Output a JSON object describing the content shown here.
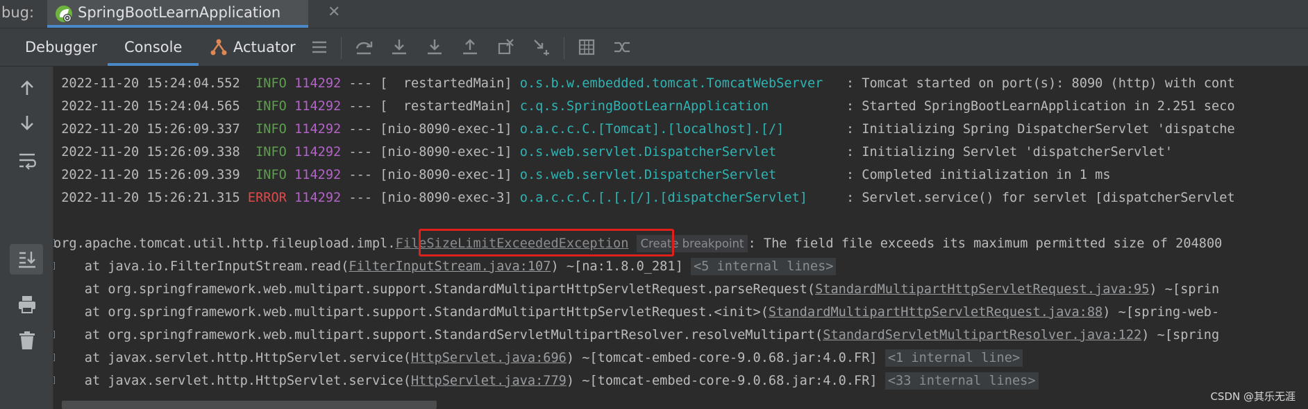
{
  "window": {
    "prefix": "bug:",
    "run_tab_title": "SpringBootLearnApplication",
    "close_glyph": "✕"
  },
  "subtabs": [
    {
      "label": "Debugger",
      "active": false
    },
    {
      "label": "Console",
      "active": true
    },
    {
      "label": "Actuator",
      "active": false
    }
  ],
  "icons": {
    "run_tab": "spring-boot-icon",
    "actuator": "actuator-icon",
    "toolbar": [
      "list-icon",
      "step-over-icon",
      "step-into-icon",
      "force-step-into-icon",
      "step-out-icon",
      "drop-frame-icon",
      "run-to-cursor-icon",
      "evaluate-icon",
      "trace-icon"
    ],
    "gutter": [
      "scroll-up-icon",
      "scroll-down-icon",
      "soft-wrap-icon",
      "scroll-to-end-icon",
      "print-icon",
      "clear-icon"
    ]
  },
  "log_lines": [
    {
      "ts": "2022-11-20 15:24:04.552",
      "level": "INFO",
      "pid": "114292",
      "sep": "---",
      "thread": "[  restartedMain]",
      "logger": "o.s.b.w.embedded.tomcat.TomcatWebServer ",
      "msg": ": Tomcat started on port(s): 8090 (http) with cont"
    },
    {
      "ts": "2022-11-20 15:24:04.565",
      "level": "INFO",
      "pid": "114292",
      "sep": "---",
      "thread": "[  restartedMain]",
      "logger": "c.q.s.SpringBootLearnApplication        ",
      "msg": ": Started SpringBootLearnApplication in 2.251 seco"
    },
    {
      "ts": "2022-11-20 15:26:09.337",
      "level": "INFO",
      "pid": "114292",
      "sep": "---",
      "thread": "[nio-8090-exec-1]",
      "logger": "o.a.c.c.C.[Tomcat].[localhost].[/]      ",
      "msg": ": Initializing Spring DispatcherServlet 'dispatche"
    },
    {
      "ts": "2022-11-20 15:26:09.338",
      "level": "INFO",
      "pid": "114292",
      "sep": "---",
      "thread": "[nio-8090-exec-1]",
      "logger": "o.s.web.servlet.DispatcherServlet       ",
      "msg": ": Initializing Servlet 'dispatcherServlet'"
    },
    {
      "ts": "2022-11-20 15:26:09.339",
      "level": "INFO",
      "pid": "114292",
      "sep": "---",
      "thread": "[nio-8090-exec-1]",
      "logger": "o.s.web.servlet.DispatcherServlet       ",
      "msg": ": Completed initialization in 1 ms"
    },
    {
      "ts": "2022-11-20 15:26:21.315",
      "level": "ERROR",
      "pid": "114292",
      "sep": "---",
      "thread": "[nio-8090-exec-3]",
      "logger": "o.a.c.c.C.[.[.[/].[dispatcherServlet]   ",
      "msg": ": Servlet.service() for servlet [dispatcherServlet"
    }
  ],
  "exception": {
    "prefix": "org.apache.tomcat.util.http.fileupload.impl.",
    "class_link": "FileSizeLimitExceededException",
    "breakpoint_hint": "Create breakpoint",
    "message": ": The field file exceeds its maximum permitted size of 204800"
  },
  "stack": [
    {
      "pre": "    at java.io.FilterInputStream.read(",
      "link": "FilterInputStream.java:107",
      "post": ") ~[na:1.8.0_281] ",
      "chip": "<5 internal lines>"
    },
    {
      "pre": "    at org.springframework.web.multipart.support.StandardMultipartHttpServletRequest.parseRequest(",
      "link": "StandardMultipartHttpServletRequest.java:95",
      "post": ") ~[sprin",
      "chip": ""
    },
    {
      "pre": "    at org.springframework.web.multipart.support.StandardMultipartHttpServletRequest.<init>(",
      "link": "StandardMultipartHttpServletRequest.java:88",
      "post": ") ~[spring-web-",
      "chip": ""
    },
    {
      "pre": "    at org.springframework.web.multipart.support.StandardServletMultipartResolver.resolveMultipart(",
      "link": "StandardServletMultipartResolver.java:122",
      "post": ") ~[spring",
      "chip": ""
    },
    {
      "pre": "    at javax.servlet.http.HttpServlet.service(",
      "link": "HttpServlet.java:696",
      "post": ") ~[tomcat-embed-core-9.0.68.jar:4.0.FR] ",
      "chip": "<1 internal line>"
    },
    {
      "pre": "    at javax.servlet.http.HttpServlet.service(",
      "link": "HttpServlet.java:779",
      "post": ") ~[tomcat-embed-core-9.0.68.jar:4.0.FR] ",
      "chip": "<33 internal lines>"
    }
  ],
  "watermark": "CSDN @其乐无涯",
  "colors": {
    "info": "#5f9e4f",
    "error": "#e24a4a",
    "pid": "#b463c9",
    "logger": "#2fb4b4",
    "highlight": "#e0201a",
    "accent": "#4a88c7"
  }
}
